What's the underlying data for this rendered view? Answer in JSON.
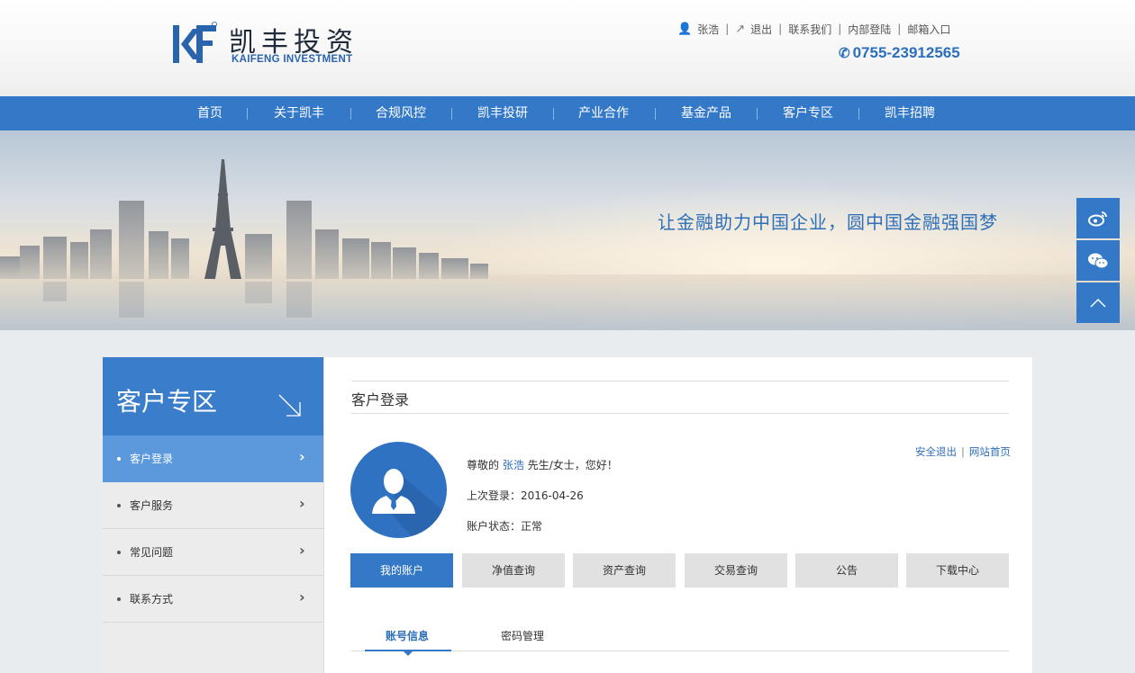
{
  "header": {
    "logo_cn": "凯丰投资",
    "logo_en": "KAIFENG INVESTMENT",
    "user_icon": "user-icon",
    "username": "张浩",
    "logout": "退出",
    "contact": "联系我们",
    "internal_login": "内部登陆",
    "mailbox": "邮箱入口",
    "phone": "0755-23912565"
  },
  "nav": {
    "items": [
      "首页",
      "关于凯丰",
      "合规风控",
      "凯丰投研",
      "产业合作",
      "基金产品",
      "客户专区",
      "凯丰招聘"
    ]
  },
  "banner": {
    "slogan": "让金融助力中国企业，圆中国金融强国梦"
  },
  "side_tools": [
    "weibo-icon",
    "wechat-icon",
    "back-to-top-icon"
  ],
  "sidebar": {
    "title": "客户专区",
    "items": [
      {
        "label": "客户登录",
        "active": true
      },
      {
        "label": "客户服务",
        "active": false
      },
      {
        "label": "常见问题",
        "active": false
      },
      {
        "label": "联系方式",
        "active": false
      }
    ]
  },
  "main": {
    "title": "客户登录",
    "greeting_prefix": "尊敬的",
    "greeting_name": "张浩",
    "greeting_suffix": "先生/女士，您好！",
    "last_login": "上次登录：2016-04-26",
    "account_status": "账户状态：正常",
    "safe_logout": "安全退出",
    "home_link": "网站首页",
    "tabs": [
      "我的账户",
      "净值查询",
      "资产查询",
      "交易查询",
      "公告",
      "下载中心"
    ],
    "subtabs": [
      "账号信息",
      "密码管理"
    ]
  },
  "colors": {
    "primary": "#3478c8",
    "sidebar_active": "#5b98dc",
    "link": "#2e6fb8"
  }
}
